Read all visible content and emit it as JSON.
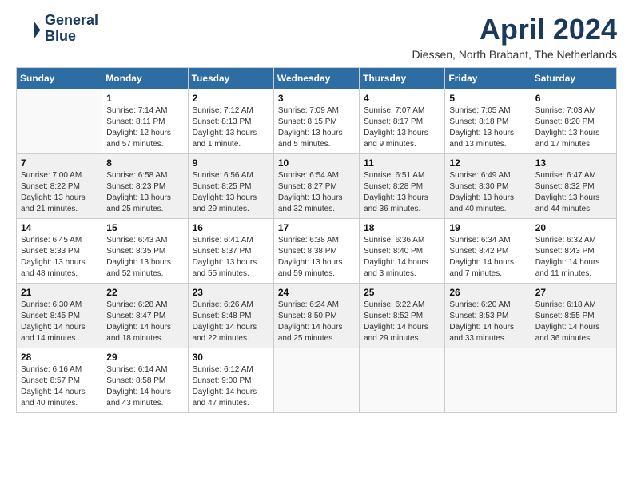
{
  "header": {
    "logo_line1": "General",
    "logo_line2": "Blue",
    "title": "April 2024",
    "location": "Diessen, North Brabant, The Netherlands"
  },
  "weekdays": [
    "Sunday",
    "Monday",
    "Tuesday",
    "Wednesday",
    "Thursday",
    "Friday",
    "Saturday"
  ],
  "weeks": [
    [
      {
        "day": "",
        "sunrise": "",
        "sunset": "",
        "daylight": ""
      },
      {
        "day": "1",
        "sunrise": "Sunrise: 7:14 AM",
        "sunset": "Sunset: 8:11 PM",
        "daylight": "Daylight: 12 hours and 57 minutes."
      },
      {
        "day": "2",
        "sunrise": "Sunrise: 7:12 AM",
        "sunset": "Sunset: 8:13 PM",
        "daylight": "Daylight: 13 hours and 1 minute."
      },
      {
        "day": "3",
        "sunrise": "Sunrise: 7:09 AM",
        "sunset": "Sunset: 8:15 PM",
        "daylight": "Daylight: 13 hours and 5 minutes."
      },
      {
        "day": "4",
        "sunrise": "Sunrise: 7:07 AM",
        "sunset": "Sunset: 8:17 PM",
        "daylight": "Daylight: 13 hours and 9 minutes."
      },
      {
        "day": "5",
        "sunrise": "Sunrise: 7:05 AM",
        "sunset": "Sunset: 8:18 PM",
        "daylight": "Daylight: 13 hours and 13 minutes."
      },
      {
        "day": "6",
        "sunrise": "Sunrise: 7:03 AM",
        "sunset": "Sunset: 8:20 PM",
        "daylight": "Daylight: 13 hours and 17 minutes."
      }
    ],
    [
      {
        "day": "7",
        "sunrise": "Sunrise: 7:00 AM",
        "sunset": "Sunset: 8:22 PM",
        "daylight": "Daylight: 13 hours and 21 minutes."
      },
      {
        "day": "8",
        "sunrise": "Sunrise: 6:58 AM",
        "sunset": "Sunset: 8:23 PM",
        "daylight": "Daylight: 13 hours and 25 minutes."
      },
      {
        "day": "9",
        "sunrise": "Sunrise: 6:56 AM",
        "sunset": "Sunset: 8:25 PM",
        "daylight": "Daylight: 13 hours and 29 minutes."
      },
      {
        "day": "10",
        "sunrise": "Sunrise: 6:54 AM",
        "sunset": "Sunset: 8:27 PM",
        "daylight": "Daylight: 13 hours and 32 minutes."
      },
      {
        "day": "11",
        "sunrise": "Sunrise: 6:51 AM",
        "sunset": "Sunset: 8:28 PM",
        "daylight": "Daylight: 13 hours and 36 minutes."
      },
      {
        "day": "12",
        "sunrise": "Sunrise: 6:49 AM",
        "sunset": "Sunset: 8:30 PM",
        "daylight": "Daylight: 13 hours and 40 minutes."
      },
      {
        "day": "13",
        "sunrise": "Sunrise: 6:47 AM",
        "sunset": "Sunset: 8:32 PM",
        "daylight": "Daylight: 13 hours and 44 minutes."
      }
    ],
    [
      {
        "day": "14",
        "sunrise": "Sunrise: 6:45 AM",
        "sunset": "Sunset: 8:33 PM",
        "daylight": "Daylight: 13 hours and 48 minutes."
      },
      {
        "day": "15",
        "sunrise": "Sunrise: 6:43 AM",
        "sunset": "Sunset: 8:35 PM",
        "daylight": "Daylight: 13 hours and 52 minutes."
      },
      {
        "day": "16",
        "sunrise": "Sunrise: 6:41 AM",
        "sunset": "Sunset: 8:37 PM",
        "daylight": "Daylight: 13 hours and 55 minutes."
      },
      {
        "day": "17",
        "sunrise": "Sunrise: 6:38 AM",
        "sunset": "Sunset: 8:38 PM",
        "daylight": "Daylight: 13 hours and 59 minutes."
      },
      {
        "day": "18",
        "sunrise": "Sunrise: 6:36 AM",
        "sunset": "Sunset: 8:40 PM",
        "daylight": "Daylight: 14 hours and 3 minutes."
      },
      {
        "day": "19",
        "sunrise": "Sunrise: 6:34 AM",
        "sunset": "Sunset: 8:42 PM",
        "daylight": "Daylight: 14 hours and 7 minutes."
      },
      {
        "day": "20",
        "sunrise": "Sunrise: 6:32 AM",
        "sunset": "Sunset: 8:43 PM",
        "daylight": "Daylight: 14 hours and 11 minutes."
      }
    ],
    [
      {
        "day": "21",
        "sunrise": "Sunrise: 6:30 AM",
        "sunset": "Sunset: 8:45 PM",
        "daylight": "Daylight: 14 hours and 14 minutes."
      },
      {
        "day": "22",
        "sunrise": "Sunrise: 6:28 AM",
        "sunset": "Sunset: 8:47 PM",
        "daylight": "Daylight: 14 hours and 18 minutes."
      },
      {
        "day": "23",
        "sunrise": "Sunrise: 6:26 AM",
        "sunset": "Sunset: 8:48 PM",
        "daylight": "Daylight: 14 hours and 22 minutes."
      },
      {
        "day": "24",
        "sunrise": "Sunrise: 6:24 AM",
        "sunset": "Sunset: 8:50 PM",
        "daylight": "Daylight: 14 hours and 25 minutes."
      },
      {
        "day": "25",
        "sunrise": "Sunrise: 6:22 AM",
        "sunset": "Sunset: 8:52 PM",
        "daylight": "Daylight: 14 hours and 29 minutes."
      },
      {
        "day": "26",
        "sunrise": "Sunrise: 6:20 AM",
        "sunset": "Sunset: 8:53 PM",
        "daylight": "Daylight: 14 hours and 33 minutes."
      },
      {
        "day": "27",
        "sunrise": "Sunrise: 6:18 AM",
        "sunset": "Sunset: 8:55 PM",
        "daylight": "Daylight: 14 hours and 36 minutes."
      }
    ],
    [
      {
        "day": "28",
        "sunrise": "Sunrise: 6:16 AM",
        "sunset": "Sunset: 8:57 PM",
        "daylight": "Daylight: 14 hours and 40 minutes."
      },
      {
        "day": "29",
        "sunrise": "Sunrise: 6:14 AM",
        "sunset": "Sunset: 8:58 PM",
        "daylight": "Daylight: 14 hours and 43 minutes."
      },
      {
        "day": "30",
        "sunrise": "Sunrise: 6:12 AM",
        "sunset": "Sunset: 9:00 PM",
        "daylight": "Daylight: 14 hours and 47 minutes."
      },
      {
        "day": "",
        "sunrise": "",
        "sunset": "",
        "daylight": ""
      },
      {
        "day": "",
        "sunrise": "",
        "sunset": "",
        "daylight": ""
      },
      {
        "day": "",
        "sunrise": "",
        "sunset": "",
        "daylight": ""
      },
      {
        "day": "",
        "sunrise": "",
        "sunset": "",
        "daylight": ""
      }
    ]
  ]
}
